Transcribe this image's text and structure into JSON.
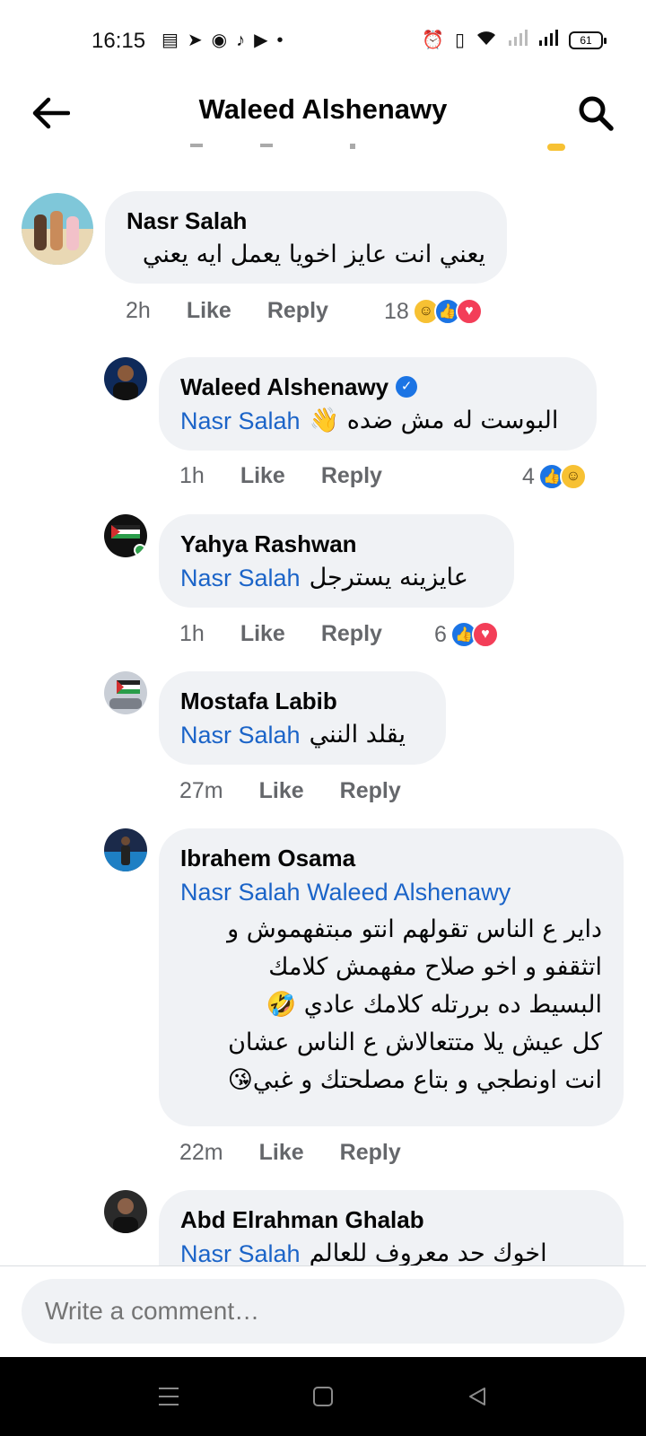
{
  "status_bar": {
    "time": "16:15",
    "battery": "61",
    "icons_left": [
      "notes-icon",
      "telegram-icon",
      "alien-app-icon",
      "tiktok-icon",
      "youtube-icon",
      "dot-icon"
    ],
    "icons_right": [
      "alarm-icon",
      "vibrate-icon",
      "wifi-icon",
      "signal-icon",
      "signal-icon"
    ]
  },
  "header": {
    "title": "Waleed Alshenawy"
  },
  "comments": [
    {
      "author": "Nasr Salah",
      "body": "يعني انت عايز اخويا يعمل ايه يعني",
      "time": "2h",
      "like": "Like",
      "reply": "Reply",
      "reaction_count": "18",
      "reactions": [
        "haha",
        "like",
        "love"
      ]
    },
    {
      "author": "Waleed Alshenawy",
      "verified": true,
      "mention": "Nasr Salah",
      "body": "البوست له مش ضده 👋",
      "time": "1h",
      "like": "Like",
      "reply": "Reply",
      "reaction_count": "4",
      "reactions": [
        "like",
        "haha"
      ]
    },
    {
      "author": "Yahya Rashwan",
      "mention": "Nasr Salah",
      "body": "عايزينه يسترجل",
      "time": "1h",
      "like": "Like",
      "reply": "Reply",
      "reaction_count": "6",
      "reactions": [
        "like",
        "love"
      ]
    },
    {
      "author": "Mostafa Labib",
      "mention": "Nasr Salah",
      "body": "يقلد النني",
      "time": "27m",
      "like": "Like",
      "reply": "Reply"
    },
    {
      "author": "Ibrahem Osama",
      "mention": "Nasr Salah Waleed Alshenawy",
      "lines": [
        "داير ع الناس تقولهم انتو مبتفهموش و",
        "اتثقفو و اخو صلاح مفهمش كلامك",
        "البسيط ده بررتله كلامك عادي 🤣",
        "كل عيش يلا متتعالاش ع الناس عشان",
        "انت اونطجي و بتاع مصلحتك و غبي😘"
      ],
      "time": "22m",
      "like": "Like",
      "reply": "Reply"
    },
    {
      "author": "Abd Elrahman Ghalab",
      "mention": "Nasr Salah",
      "body": "اخوك حد معروف للعالم"
    }
  ],
  "composer": {
    "placeholder": "Write a comment…"
  },
  "colors": {
    "bubble": "#f0f2f5",
    "mention": "#1b64c8",
    "meta": "#65676b",
    "like": "#1b74e4",
    "love": "#f33e58",
    "haha": "#f7c133"
  }
}
